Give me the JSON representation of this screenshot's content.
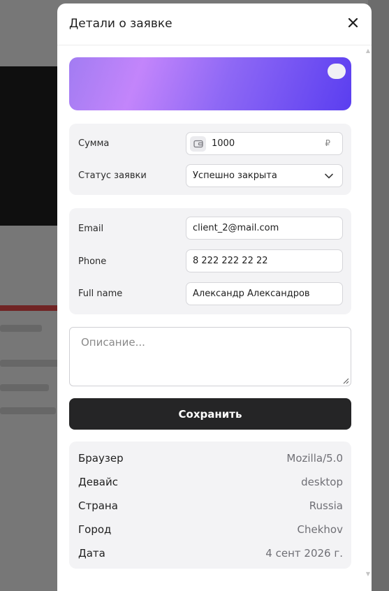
{
  "modal": {
    "title": "Детали о заявке"
  },
  "amount": {
    "label": "Сумма",
    "value": "1000",
    "currency": "₽"
  },
  "status": {
    "label": "Статус заявки",
    "value": "Успешно закрыта"
  },
  "contact": {
    "email_label": "Email",
    "email_value": "client_2@mail.com",
    "phone_label": "Phone",
    "phone_value": "8 222 222 22 22",
    "name_label": "Full name",
    "name_value": "Александр Александров"
  },
  "description": {
    "placeholder": "Описание..."
  },
  "save_label": "Сохранить",
  "info": [
    {
      "key": "Браузер",
      "value": "Mozilla/5.0"
    },
    {
      "key": "Девайс",
      "value": "desktop"
    },
    {
      "key": "Страна",
      "value": "Russia"
    },
    {
      "key": "Город",
      "value": "Chekhov"
    },
    {
      "key": "Дата",
      "value": "4 сент 2026 г."
    }
  ],
  "colors": {
    "primary_button": "#252526",
    "banner_gradient": [
      "#a27cf2",
      "#c385fb",
      "#5a3ef0"
    ]
  }
}
